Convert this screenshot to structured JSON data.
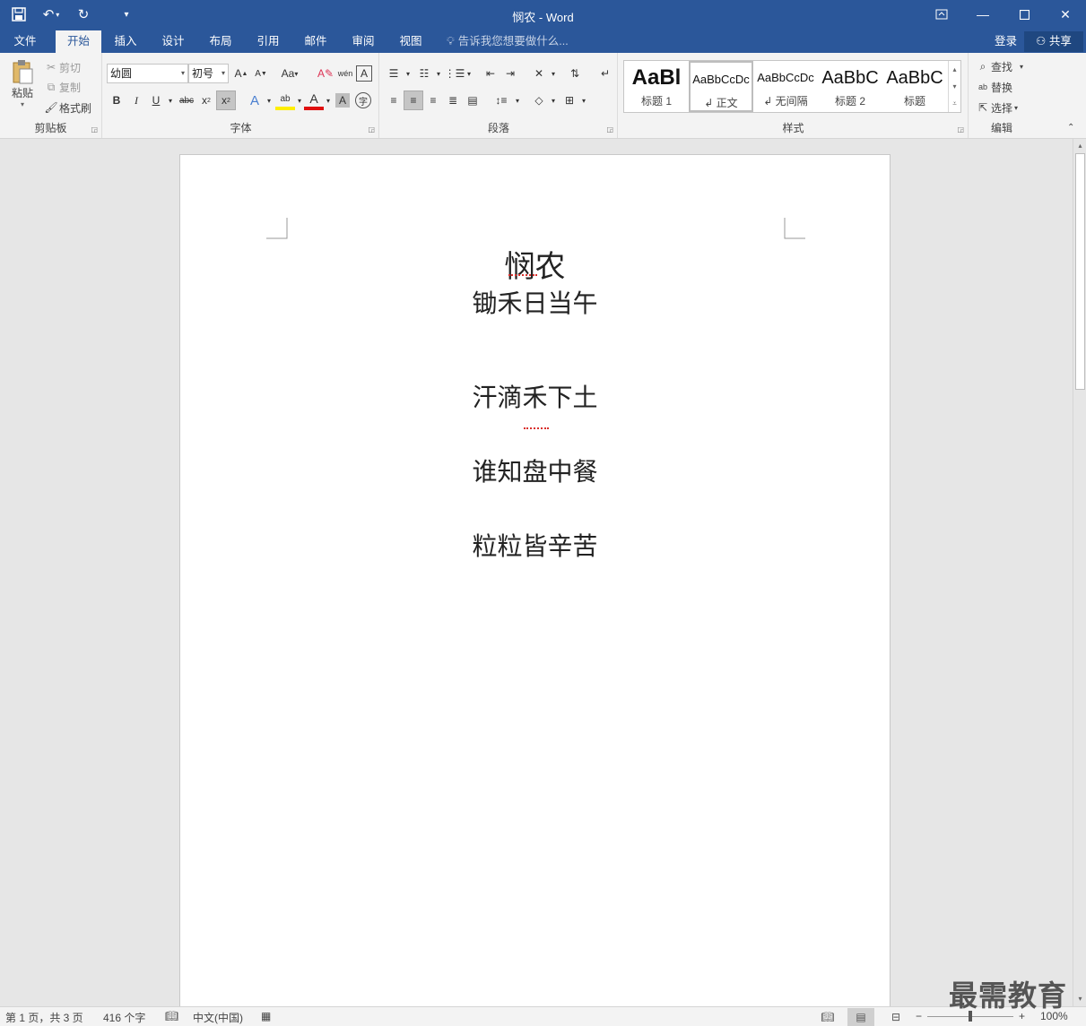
{
  "window": {
    "title": "悯农 - Word",
    "quick_access": {
      "save_icon": "save-icon",
      "undo_icon": "undo-icon",
      "redo_icon": "redo-icon",
      "customize_icon": "customize-icon"
    }
  },
  "tabs": {
    "items": [
      "文件",
      "开始",
      "插入",
      "设计",
      "布局",
      "引用",
      "邮件",
      "审阅",
      "视图"
    ],
    "active": "开始",
    "tell_me": "告诉我您想要做什么...",
    "login": "登录",
    "share": "共享"
  },
  "ribbon": {
    "clipboard": {
      "label": "剪贴板",
      "paste": "粘贴",
      "cut": "剪切",
      "copy": "复制",
      "format_painter": "格式刷"
    },
    "font": {
      "label": "字体",
      "font_name": "幼圆",
      "font_size": "初号",
      "change_case": "Aa"
    },
    "paragraph": {
      "label": "段落"
    },
    "styles": {
      "label": "样式",
      "items": [
        {
          "preview": "AaBl",
          "name": "标题 1"
        },
        {
          "preview": "AaBbCcDc",
          "name": "↲ 正文"
        },
        {
          "preview": "AaBbCcDc",
          "name": "↲ 无间隔"
        },
        {
          "preview": "AaBbC",
          "name": "标题 2"
        },
        {
          "preview": "AaBbC",
          "name": "标题"
        }
      ]
    },
    "editing": {
      "label": "编辑",
      "find": "查找",
      "replace": "替换",
      "select": "选择"
    }
  },
  "document": {
    "title": "悯农",
    "lines": [
      "锄禾日当午",
      "汗滴禾下土",
      "谁知盘中餐",
      "粒粒皆辛苦"
    ]
  },
  "status": {
    "page": "第 1 页，共 3 页",
    "words": "416 个字",
    "language": "中文(中国)",
    "zoom": "100%"
  },
  "watermark": "最需教育"
}
